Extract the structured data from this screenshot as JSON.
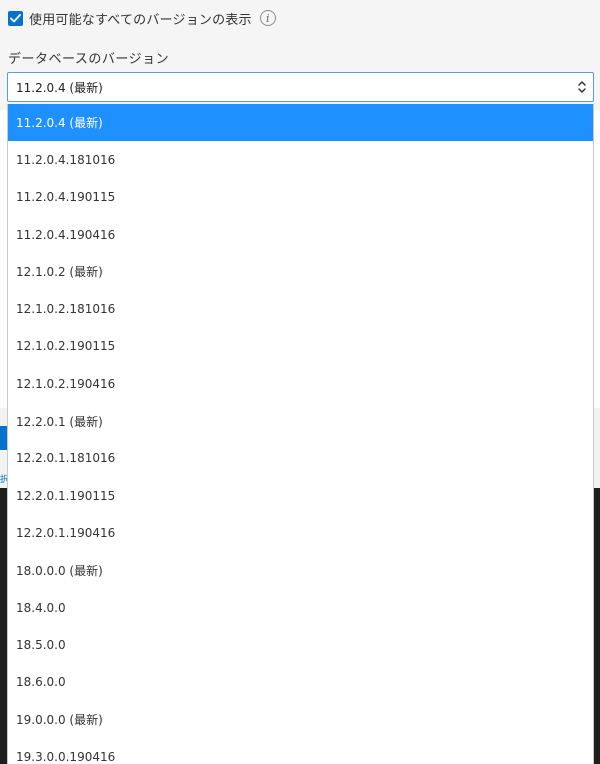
{
  "checkbox": {
    "label": "使用可能なすべてのバージョンの表示",
    "checked": true
  },
  "info_icon": "info-icon",
  "field": {
    "label": "データベースのバージョン",
    "selected_value": "11.2.0.4 (最新)"
  },
  "options": [
    "11.2.0.4 (最新)",
    "11.2.0.4.181016",
    "11.2.0.4.190115",
    "11.2.0.4.190416",
    "12.1.0.2 (最新)",
    "12.1.0.2.181016",
    "12.1.0.2.190115",
    "12.1.0.2.190416",
    "12.2.0.1 (最新)",
    "12.2.0.1.181016",
    "12.2.0.1.190115",
    "12.2.0.1.190416",
    "18.0.0.0 (最新)",
    "18.4.0.0",
    "18.5.0.0",
    "18.6.0.0",
    "19.0.0.0 (最新)",
    "19.3.0.0.190416"
  ],
  "selected_index": 0,
  "background": {
    "link_fragment": "択"
  },
  "colors": {
    "accent": "#0572ce",
    "highlight": "#1e90ff",
    "select_border": "#5d9be0"
  }
}
